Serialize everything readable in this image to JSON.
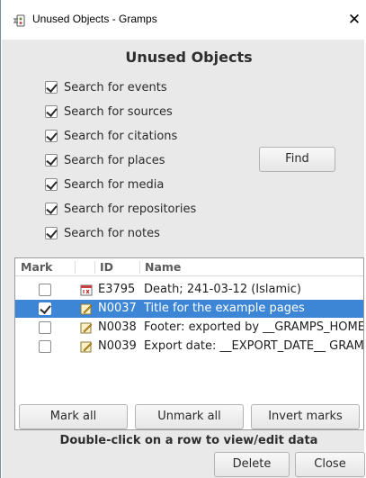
{
  "window": {
    "title": "Unused Objects - Gramps",
    "close_label": "✕"
  },
  "dialog": {
    "heading": "Unused Objects",
    "options": [
      {
        "label": "Search for events",
        "checked": true
      },
      {
        "label": "Search for sources",
        "checked": true
      },
      {
        "label": "Search for citations",
        "checked": true
      },
      {
        "label": "Search for places",
        "checked": true
      },
      {
        "label": "Search for media",
        "checked": true
      },
      {
        "label": "Search for repositories",
        "checked": true
      },
      {
        "label": "Search for notes",
        "checked": true
      }
    ],
    "find_label": "Find"
  },
  "table": {
    "columns": {
      "mark": "Mark",
      "id": "ID",
      "name": "Name"
    },
    "rows": [
      {
        "mark": false,
        "icon": "event-icon",
        "id": "E3795",
        "name": "Death; 241-03-12 (Islamic)",
        "selected": false
      },
      {
        "mark": true,
        "icon": "note-icon",
        "id": "N0037",
        "name": "Title for the example pages",
        "selected": true
      },
      {
        "mark": false,
        "icon": "note-icon",
        "id": "N0038",
        "name": "Footer: exported by __GRAMPS_HOMEPAGE",
        "selected": false
      },
      {
        "mark": false,
        "icon": "note-icon",
        "id": "N0039",
        "name": "Export date: __EXPORT_DATE__ GRAMPS",
        "selected": false
      }
    ]
  },
  "buttons": {
    "mark_all": "Mark all",
    "unmark_all": "Unmark all",
    "invert_marks": "Invert marks",
    "delete": "Delete",
    "close": "Close"
  },
  "hint": "Double-click on a row to view/edit data",
  "colors": {
    "selection": "#3d86d6",
    "dialog_background": "#e9e9e9"
  }
}
